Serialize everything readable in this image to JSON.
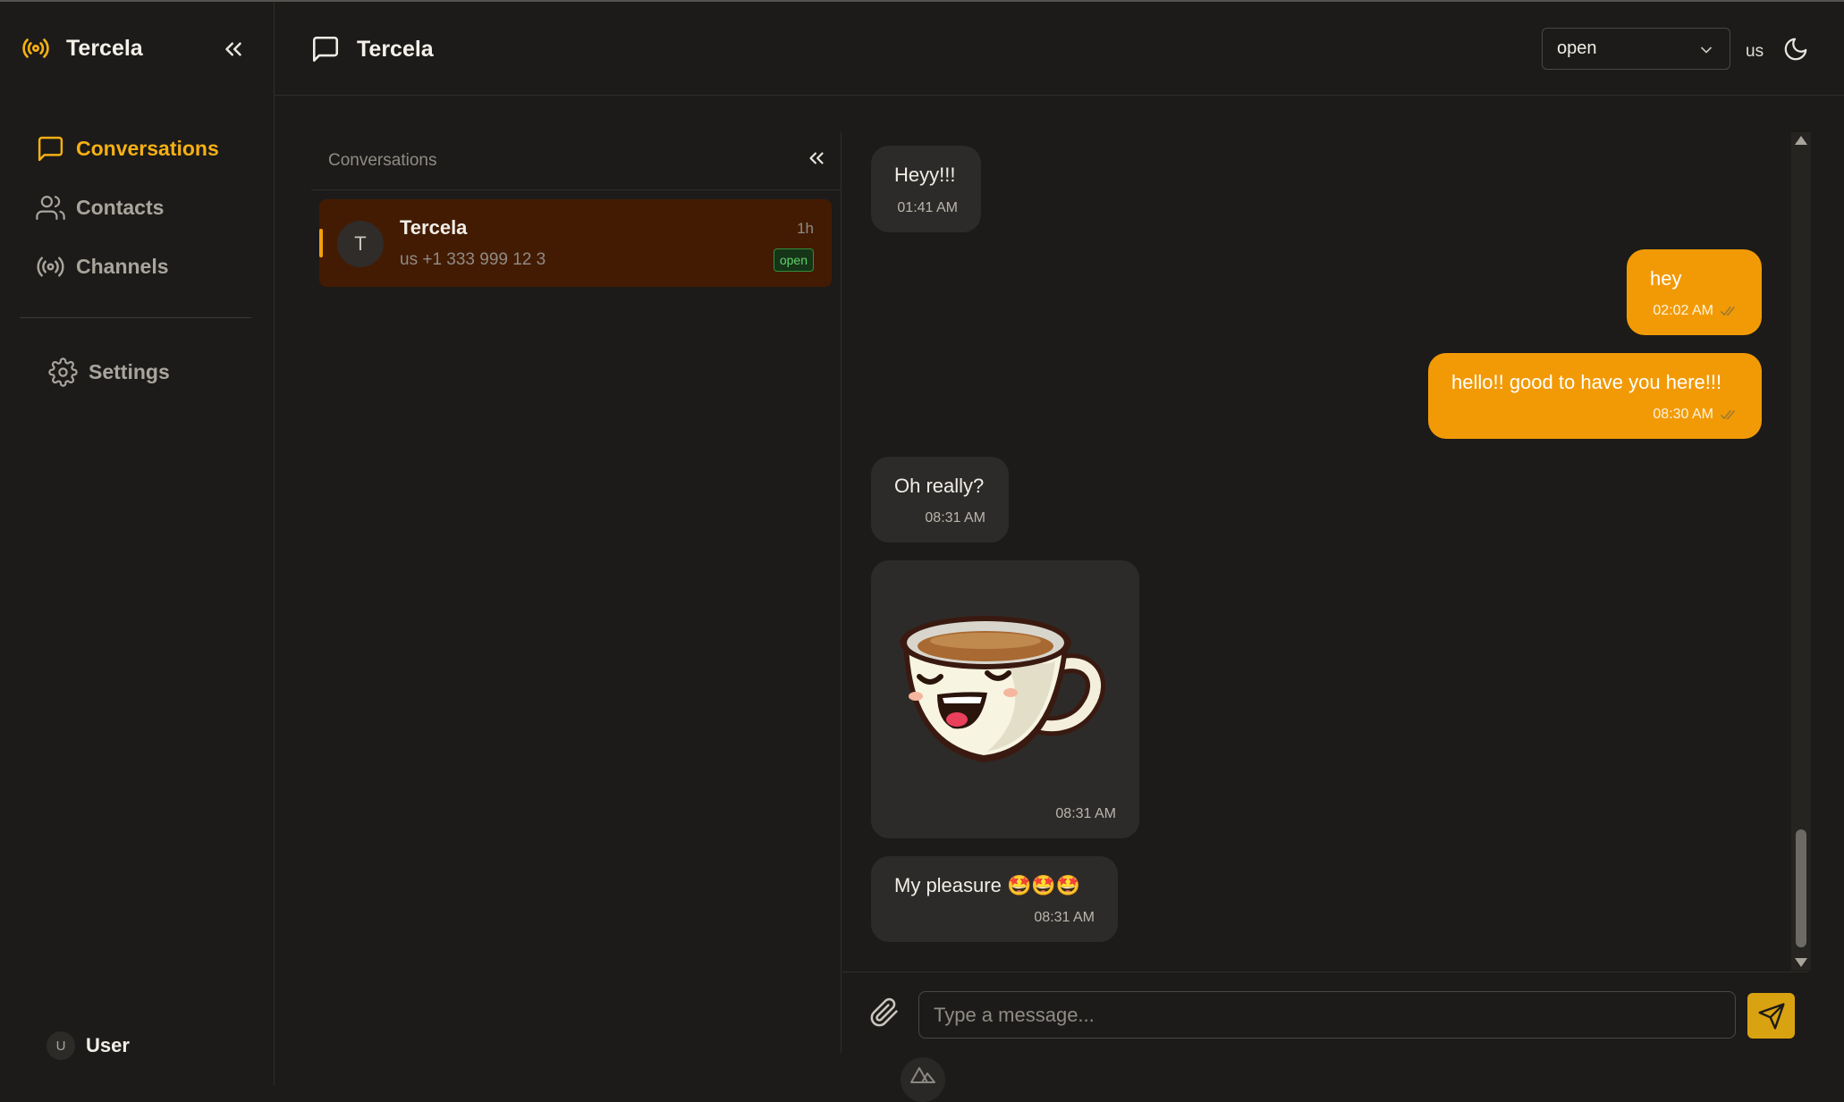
{
  "app": {
    "name": "Tercela"
  },
  "sidebar": {
    "items": [
      {
        "label": "Conversations",
        "icon": "message-square-icon",
        "active": true
      },
      {
        "label": "Contacts",
        "icon": "users-icon",
        "active": false
      },
      {
        "label": "Channels",
        "icon": "radio-icon",
        "active": false
      }
    ],
    "settings": {
      "label": "Settings",
      "icon": "gear-icon"
    },
    "user": {
      "initial": "U",
      "name": "User"
    }
  },
  "header": {
    "title": "Tercela",
    "status_select": {
      "value": "open"
    },
    "locale": "us",
    "theme_icon": "moon-icon"
  },
  "conversations": {
    "title": "Conversations",
    "items": [
      {
        "initial": "T",
        "name": "Tercela",
        "subtitle": "us +1 333 999 12 3",
        "time": "1h",
        "status": "open"
      }
    ]
  },
  "messages": [
    {
      "direction": "in",
      "text": "Heyy!!!",
      "time": "01:41 AM"
    },
    {
      "direction": "out",
      "text": "hey",
      "time": "02:02 AM",
      "read": true
    },
    {
      "direction": "out",
      "text": "hello!! good to have you here!!!",
      "time": "08:30 AM",
      "read": true
    },
    {
      "direction": "in",
      "text": "Oh really?",
      "time": "08:31 AM"
    },
    {
      "direction": "in",
      "type": "sticker",
      "sticker": "laughing-coffee-cup",
      "time": "08:31 AM"
    },
    {
      "direction": "in",
      "text": "My pleasure 🤩🤩🤩",
      "time": "08:31 AM"
    }
  ],
  "composer": {
    "placeholder": "Type a message..."
  },
  "colors": {
    "accent": "#f5b014",
    "outgoing_bubble": "#f29a05",
    "incoming_bubble": "#2d2b29",
    "selected_conversation": "#431b03",
    "background": "#1c1b19"
  }
}
